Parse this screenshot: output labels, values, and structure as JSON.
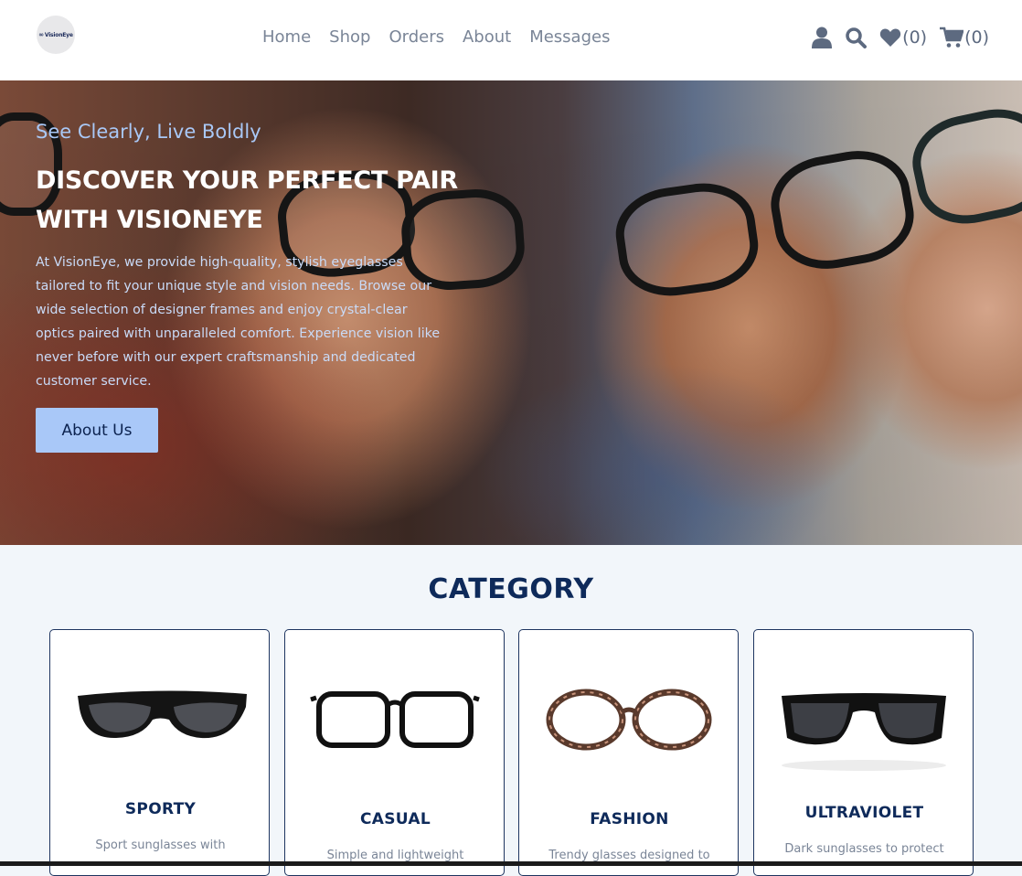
{
  "brand": {
    "logo_text": "VisionEye"
  },
  "nav": {
    "links": [
      "Home",
      "Shop",
      "Orders",
      "About",
      "Messages"
    ],
    "wishlist_count": "(0)",
    "cart_count": "(0)"
  },
  "hero": {
    "tagline": "See Clearly, Live Boldly",
    "title": "DISCOVER YOUR PERFECT PAIR WITH VISIONEYE",
    "description": "At VisionEye, we provide high-quality, stylish eyeglasses tailored to fit your unique style and vision needs. Browse our wide selection of designer frames and enjoy crystal-clear optics paired with unparalleled comfort. Experience vision like never before with our expert craftsmanship and dedicated customer service.",
    "button_label": "About Us"
  },
  "category": {
    "heading": "CATEGORY",
    "cards": [
      {
        "title": "SPORTY",
        "description": "Sport sunglasses with",
        "icon": "sporty-sunglasses-image"
      },
      {
        "title": "CASUAL",
        "description": "Simple and lightweight",
        "icon": "casual-glasses-image"
      },
      {
        "title": "FASHION",
        "description": "Trendy glasses designed to",
        "icon": "fashion-glasses-image"
      },
      {
        "title": "ULTRAVIOLET",
        "description": "Dark sunglasses to protect",
        "icon": "ultraviolet-sunglasses-image"
      }
    ]
  },
  "colors": {
    "accent": "#a9c8f8",
    "heading": "#0e2a5a",
    "nav_text": "#7a8597"
  }
}
